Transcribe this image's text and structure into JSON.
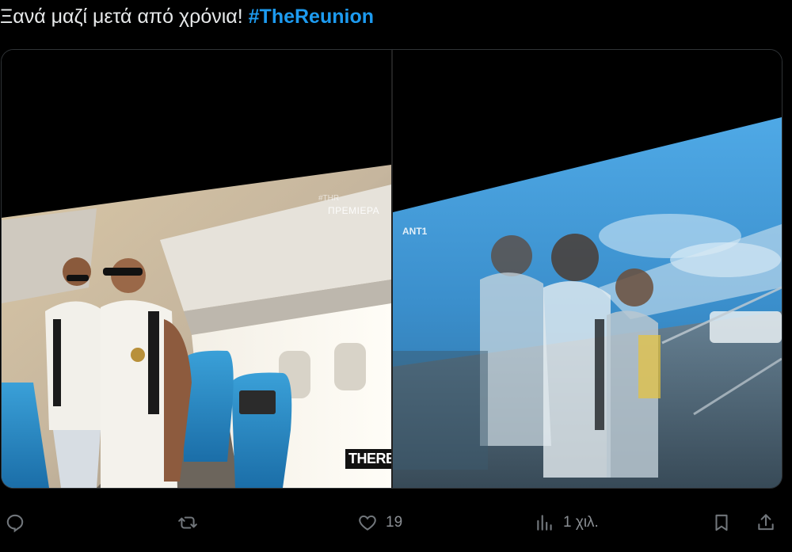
{
  "tweet": {
    "text": "Ξανά μαζί μετά από χρόνια! ",
    "hashtag": "#TheReunion"
  },
  "media": {
    "left_overlay_tag": "ΠΡΕΜΙΕΡΑ",
    "left_logo_text": "THEREU",
    "left_channel_mark": "#THR",
    "right_channel_logo": "ANT1"
  },
  "actions": {
    "reply": {
      "icon": "reply-icon"
    },
    "retweet": {
      "icon": "retweet-icon"
    },
    "like": {
      "icon": "heart-icon",
      "count": "19"
    },
    "views": {
      "icon": "views-icon",
      "count": "1 χιλ."
    },
    "bookmark": {
      "icon": "bookmark-icon"
    },
    "share": {
      "icon": "share-icon"
    }
  },
  "colors": {
    "background": "#000000",
    "text": "#e7e9ea",
    "hashtag": "#1d9bf0",
    "action_icon": "#71767b"
  }
}
